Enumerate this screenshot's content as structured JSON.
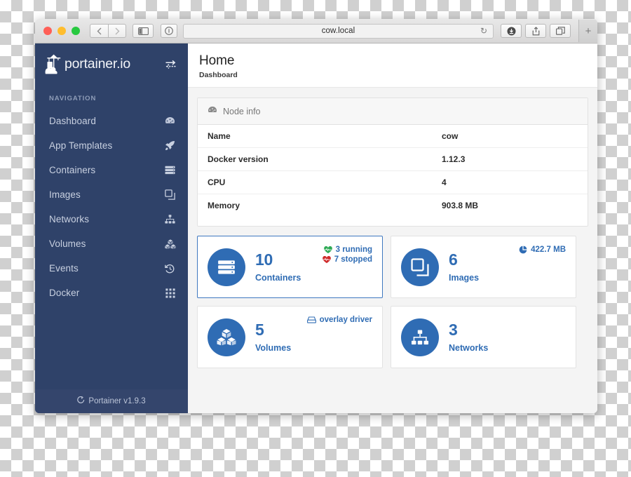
{
  "browser": {
    "url": "cow.local",
    "back_icon": "chevron-left-icon",
    "forward_icon": "chevron-right-icon",
    "sidebar_toggle_icon": "sidebar-toggle-icon",
    "reader_icon": "reader-view-icon",
    "reload_icon": "reload-icon",
    "download_icon": "download-icon",
    "share_icon": "share-icon",
    "tabs_icon": "tab-overview-icon",
    "new_tab_icon": "plus-icon"
  },
  "sidebar": {
    "brand": "portainer.io",
    "brand_logo_icon": "portainer-crane-logo-icon",
    "toggle_icon": "endpoint-switch-icon",
    "nav_title": "NAVIGATION",
    "items": [
      {
        "label": "Dashboard",
        "icon": "dashboard-icon"
      },
      {
        "label": "App Templates",
        "icon": "rocket-icon"
      },
      {
        "label": "Containers",
        "icon": "server-stack-icon"
      },
      {
        "label": "Images",
        "icon": "clone-icon"
      },
      {
        "label": "Networks",
        "icon": "sitemap-icon"
      },
      {
        "label": "Volumes",
        "icon": "cubes-icon"
      },
      {
        "label": "Events",
        "icon": "history-icon"
      },
      {
        "label": "Docker",
        "icon": "grid-icon"
      }
    ],
    "footer": {
      "icon": "github-icon",
      "text": "Portainer v1.9.3"
    }
  },
  "page": {
    "title": "Home",
    "subtitle": "Dashboard"
  },
  "node_info": {
    "header": "Node info",
    "header_icon": "dashboard-icon",
    "rows": [
      {
        "key": "Name",
        "value": "cow"
      },
      {
        "key": "Docker version",
        "value": "1.12.3"
      },
      {
        "key": "CPU",
        "value": "4"
      },
      {
        "key": "Memory",
        "value": "903.8 MB"
      }
    ]
  },
  "cards": [
    {
      "count": "10",
      "label": "Containers",
      "icon": "server-stack-icon",
      "active": true,
      "side": [
        {
          "text": "3 running",
          "icon": "heartbeat-icon",
          "color": "#2eaa55"
        },
        {
          "text": "7 stopped",
          "icon": "heartbeat-icon",
          "color": "#cf2b2b"
        }
      ]
    },
    {
      "count": "6",
      "label": "Images",
      "icon": "clone-icon",
      "active": false,
      "side": [
        {
          "text": "422.7 MB",
          "icon": "pie-chart-icon",
          "color": "#2f6cb4"
        }
      ]
    },
    {
      "count": "5",
      "label": "Volumes",
      "icon": "cubes-icon",
      "active": false,
      "side": [
        {
          "text": "overlay driver",
          "icon": "hdd-icon",
          "color": "#2f6cb4"
        }
      ]
    },
    {
      "count": "3",
      "label": "Networks",
      "icon": "sitemap-icon",
      "active": false,
      "side": []
    }
  ],
  "colors": {
    "sidebar_bg": "#2f4269",
    "accent_blue": "#2f6cb4",
    "status_running": "#2eaa55",
    "status_stopped": "#cf2b2b",
    "content_bg": "#f4f4f4"
  }
}
